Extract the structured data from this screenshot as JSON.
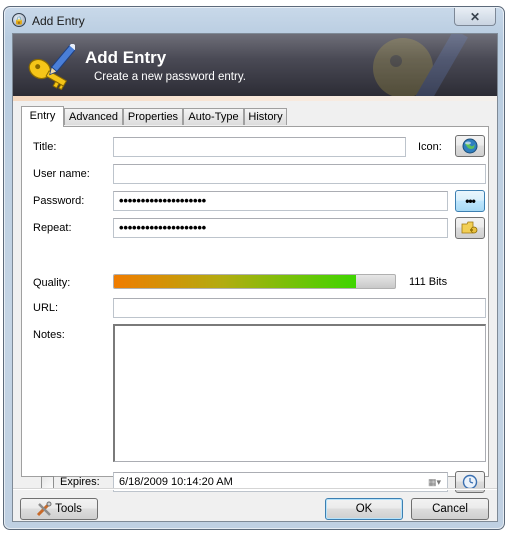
{
  "window": {
    "title": "Add Entry",
    "close_label": "✕"
  },
  "banner": {
    "title": "Add Entry",
    "subtitle": "Create a new password entry."
  },
  "tabs": [
    {
      "label": "Entry",
      "active": true
    },
    {
      "label": "Advanced",
      "active": false
    },
    {
      "label": "Properties",
      "active": false
    },
    {
      "label": "Auto-Type",
      "active": false
    },
    {
      "label": "History",
      "active": false
    }
  ],
  "form": {
    "title": {
      "label": "Title:",
      "value": ""
    },
    "icon_label": "Icon:",
    "icon_name": "globe-icon",
    "username": {
      "label": "User name:",
      "value": ""
    },
    "password": {
      "label": "Password:",
      "value": "••••••••••••••••••••",
      "reveal_button_label": "•••"
    },
    "repeat": {
      "label": "Repeat:",
      "value": "••••••••••••••••••••",
      "generator_icon": "key-folder-icon"
    },
    "quality": {
      "label": "Quality:",
      "percent": 86,
      "bits_text": "111 Bits"
    },
    "url": {
      "label": "URL:",
      "value": ""
    },
    "notes": {
      "label": "Notes:",
      "value": ""
    },
    "expires": {
      "label": "Expires:",
      "checked": false,
      "value": "6/18/2009 10:14:20 AM",
      "clock_icon": "clock-icon"
    }
  },
  "footer": {
    "tools_label": "Tools",
    "ok_label": "OK",
    "cancel_label": "Cancel"
  },
  "colors": {
    "banner_dark": "#2c2c35",
    "quality_start": "#f07c00",
    "quality_end": "#3ed500",
    "default_button_border": "#3c7fb1"
  }
}
